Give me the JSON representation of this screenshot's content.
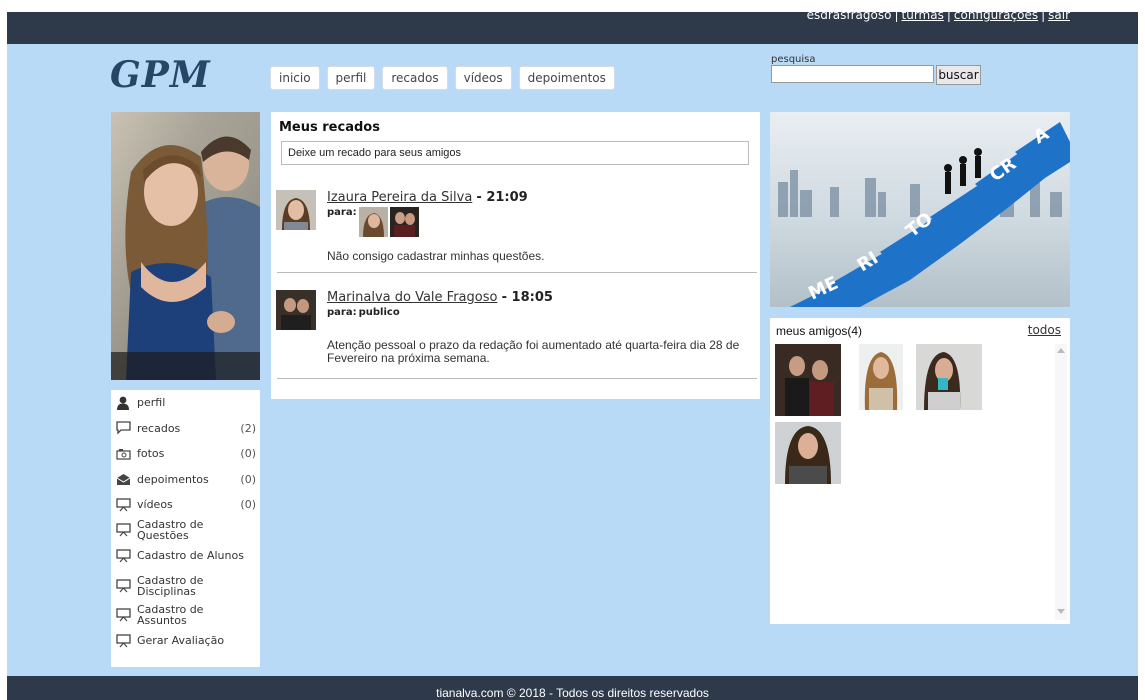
{
  "header": {
    "username": "esdrasfragoso",
    "links": [
      "turmas",
      "configurações",
      "sair"
    ],
    "logo": "GPM"
  },
  "nav": {
    "tabs": [
      "inicio",
      "perfil",
      "recados",
      "vídeos",
      "depoimentos"
    ]
  },
  "search": {
    "label": "pesquisa",
    "value": "",
    "button_label": "buscar"
  },
  "sidebar": {
    "items": [
      {
        "label": "perfil",
        "count": "",
        "icon": "user-icon"
      },
      {
        "label": "recados",
        "count": "(2)",
        "icon": "speech-bubble-icon"
      },
      {
        "label": "fotos",
        "count": "(0)",
        "icon": "photos-icon"
      },
      {
        "label": "depoimentos",
        "count": "(0)",
        "icon": "envelope-icon"
      },
      {
        "label": "vídeos",
        "count": "(0)",
        "icon": "video-board-icon"
      },
      {
        "label": "Cadastro de Questões",
        "count": "",
        "icon": "board-icon"
      },
      {
        "label": "Cadastro de Alunos",
        "count": "",
        "icon": "board-icon"
      },
      {
        "label": "Cadastro de Disciplinas",
        "count": "",
        "icon": "board-icon"
      },
      {
        "label": "Cadastro de Assuntos",
        "count": "",
        "icon": "board-icon"
      },
      {
        "label": "Gerar Avaliação",
        "count": "",
        "icon": "board-icon"
      }
    ]
  },
  "main": {
    "title": "Meus recados",
    "input_value": "Deixe um recado para seus amigos",
    "messages": [
      {
        "author": "Izaura Pereira da Silva",
        "time": "21:09",
        "para_label": "para:",
        "para_value": "",
        "text": "Não consigo cadastrar minhas questões."
      },
      {
        "author": "Marinalva do Vale Fragoso",
        "time": "18:05",
        "para_label": "para:",
        "para_value": "publico",
        "text": "Atenção pessoal o prazo da redação foi aumentado até quarta-feira dia 28 de Fevereiro na próxima semana."
      }
    ]
  },
  "banner": {
    "letters": [
      "ME",
      "RI",
      "TO",
      "CR",
      "A"
    ]
  },
  "friends": {
    "title": "meus amigos(4)",
    "all_link": "todos"
  },
  "footer": {
    "text": "tianalva.com © 2018 - Todos os direitos reservados"
  },
  "colors": {
    "page_bg": "#b9daf7",
    "bar": "#2e3a4a",
    "logo": "#274766",
    "stair": "#1e73c8"
  }
}
